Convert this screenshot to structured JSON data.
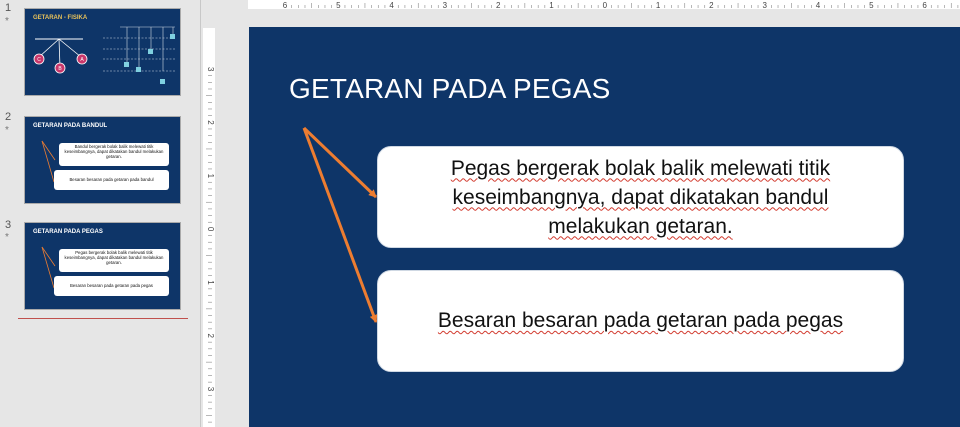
{
  "thumbnails": [
    {
      "number": "1",
      "star": "*",
      "title": "GETARAN - FISIKA",
      "pendulum_labels": [
        "C",
        "B",
        "A"
      ]
    },
    {
      "number": "2",
      "star": "*",
      "title": "GETARAN PADA BANDUL",
      "box1": "Bandul bergerak bolak balik melewati titik keseimbangnya, dapat dikatakan bandul melakukan getaran.",
      "box2": "Besaran besaran pada getaran pada bandul"
    },
    {
      "number": "3",
      "star": "*",
      "title": "GETARAN PADA PEGAS",
      "box1": "Pegas bergerak bolak balik melewati titik keseimbangnya, dapat dikatakan bandul melakukan getaran.",
      "box2": "Besaran besaran pada getaran pada pegas"
    }
  ],
  "ruler": {
    "horizontal_labels": [
      "6",
      "5",
      "4",
      "3",
      "2",
      "1",
      "0",
      "1",
      "2",
      "3",
      "4",
      "5",
      "6"
    ],
    "vertical_labels": [
      "3",
      "2",
      "1",
      "0",
      "1",
      "2",
      "3"
    ]
  },
  "slide": {
    "title": "GETARAN PADA PEGAS",
    "box1_lines": [
      "Pegas bergerak bolak balik melewati titik",
      "keseimbangnya, dapat dikatakan bandul",
      "melakukan getaran."
    ],
    "box2_text": "Besaran besaran pada getaran pada pegas"
  },
  "colors": {
    "slide_bg": "#0e3568",
    "arrow": "#ed7d31",
    "thumb_title_gold": "#e8c25a",
    "selection": "#c0504d"
  }
}
